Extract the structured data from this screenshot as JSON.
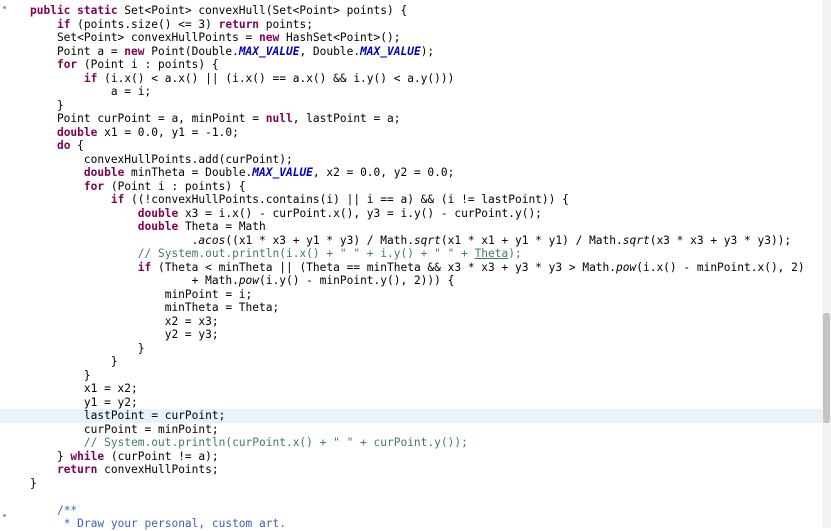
{
  "editor": {
    "current_line_index": 30,
    "lines": [
      [
        [
          "kw",
          "public static "
        ],
        [
          "plain",
          "Set<Point> convexHull(Set<Point> points) {"
        ]
      ],
      [
        [
          "plain",
          "    "
        ],
        [
          "kw",
          "if"
        ],
        [
          "plain",
          " (points.size() <= 3) "
        ],
        [
          "kw",
          "return"
        ],
        [
          "plain",
          " points;"
        ]
      ],
      [
        [
          "plain",
          "    Set<Point> convexHullPoints = "
        ],
        [
          "kw",
          "new"
        ],
        [
          "plain",
          " HashSet<Point>();"
        ]
      ],
      [
        [
          "plain",
          "    Point a = "
        ],
        [
          "kw",
          "new"
        ],
        [
          "plain",
          " Point(Double."
        ],
        [
          "static",
          "MAX_VALUE"
        ],
        [
          "plain",
          ", Double."
        ],
        [
          "static",
          "MAX_VALUE"
        ],
        [
          "plain",
          ");"
        ]
      ],
      [
        [
          "plain",
          "    "
        ],
        [
          "kw",
          "for"
        ],
        [
          "plain",
          " (Point i : points) {"
        ]
      ],
      [
        [
          "plain",
          "        "
        ],
        [
          "kw",
          "if"
        ],
        [
          "plain",
          " (i.x() < a.x() || (i.x() == a.x() && i.y() < a.y()))"
        ]
      ],
      [
        [
          "plain",
          "            a = i;"
        ]
      ],
      [
        [
          "plain",
          "    }"
        ]
      ],
      [
        [
          "plain",
          "    Point curPoint = a, minPoint = "
        ],
        [
          "kw",
          "null"
        ],
        [
          "plain",
          ", lastPoint = a;"
        ]
      ],
      [
        [
          "plain",
          "    "
        ],
        [
          "kw",
          "double"
        ],
        [
          "plain",
          " x1 = 0.0, y1 = -1.0;"
        ]
      ],
      [
        [
          "plain",
          "    "
        ],
        [
          "kw",
          "do"
        ],
        [
          "plain",
          " {"
        ]
      ],
      [
        [
          "plain",
          "        convexHullPoints.add(curPoint);"
        ]
      ],
      [
        [
          "plain",
          "        "
        ],
        [
          "kw",
          "double"
        ],
        [
          "plain",
          " minTheta = Double."
        ],
        [
          "static",
          "MAX_VALUE"
        ],
        [
          "plain",
          ", x2 = 0.0, y2 = 0.0;"
        ]
      ],
      [
        [
          "plain",
          "        "
        ],
        [
          "kw",
          "for"
        ],
        [
          "plain",
          " (Point i : points) {"
        ]
      ],
      [
        [
          "plain",
          "            "
        ],
        [
          "kw",
          "if"
        ],
        [
          "plain",
          " ((!convexHullPoints.contains(i) || i == a) && (i != lastPoint)) {"
        ]
      ],
      [
        [
          "plain",
          "                "
        ],
        [
          "kw",
          "double"
        ],
        [
          "plain",
          " x3 = i.x() - curPoint.x(), y3 = i.y() - curPoint.y();"
        ]
      ],
      [
        [
          "plain",
          "                "
        ],
        [
          "kw",
          "double"
        ],
        [
          "plain",
          " Theta = Math"
        ]
      ],
      [
        [
          "plain",
          "                        ."
        ],
        [
          "smethod",
          "acos"
        ],
        [
          "plain",
          "((x1 * x3 + y1 * y3) / Math."
        ],
        [
          "smethod",
          "sqrt"
        ],
        [
          "plain",
          "(x1 * x1 + y1 * y1) / Math."
        ],
        [
          "smethod",
          "sqrt"
        ],
        [
          "plain",
          "(x3 * x3 + y3 * y3));"
        ]
      ],
      [
        [
          "plain",
          "                "
        ],
        [
          "comment",
          "// System.out.println(i.x() + \" \" + i.y() + \" \" + "
        ],
        [
          "commentlink",
          "Theta"
        ],
        [
          "comment",
          ");"
        ]
      ],
      [
        [
          "plain",
          "                "
        ],
        [
          "kw",
          "if"
        ],
        [
          "plain",
          " (Theta < minTheta || (Theta == minTheta && x3 * x3 + y3 * y3 > Math."
        ],
        [
          "smethod",
          "pow"
        ],
        [
          "plain",
          "(i.x() - minPoint.x(), 2)"
        ]
      ],
      [
        [
          "plain",
          "                        + Math."
        ],
        [
          "smethod",
          "pow"
        ],
        [
          "plain",
          "(i.y() - minPoint.y(), 2))) {"
        ]
      ],
      [
        [
          "plain",
          "                    minPoint = i;"
        ]
      ],
      [
        [
          "plain",
          "                    minTheta = Theta;"
        ]
      ],
      [
        [
          "plain",
          "                    x2 = x3;"
        ]
      ],
      [
        [
          "plain",
          "                    y2 = y3;"
        ]
      ],
      [
        [
          "plain",
          "                }"
        ]
      ],
      [
        [
          "plain",
          "            }"
        ]
      ],
      [
        [
          "plain",
          "        }"
        ]
      ],
      [
        [
          "plain",
          "        x1 = x2;"
        ]
      ],
      [
        [
          "plain",
          "        y1 = y2;"
        ]
      ],
      [
        [
          "plain",
          "        lastPoint = curPoint;"
        ]
      ],
      [
        [
          "plain",
          "        curPoint = minPoint;"
        ]
      ],
      [
        [
          "plain",
          "        "
        ],
        [
          "comment",
          "// System.out.println(curPoint.x() + \" \" + curPoint.y());"
        ]
      ],
      [
        [
          "plain",
          "    } "
        ],
        [
          "kw",
          "while"
        ],
        [
          "plain",
          " (curPoint != a);"
        ]
      ],
      [
        [
          "plain",
          "    "
        ],
        [
          "kw",
          "return"
        ],
        [
          "plain",
          " convexHullPoints;"
        ]
      ],
      [
        [
          "plain",
          "}"
        ]
      ],
      [
        [
          "plain",
          ""
        ]
      ],
      [
        [
          "plain",
          "    "
        ],
        [
          "javadoc",
          "/**"
        ]
      ],
      [
        [
          "plain",
          "     "
        ],
        [
          "javadoc",
          "* Draw your personal, custom art."
        ]
      ]
    ]
  },
  "colors": {
    "keyword": "#7f0055",
    "static_field": "#0000c0",
    "comment": "#3f7f5f",
    "javadoc": "#3f5fbf",
    "current_line": "#e8f2fe"
  }
}
